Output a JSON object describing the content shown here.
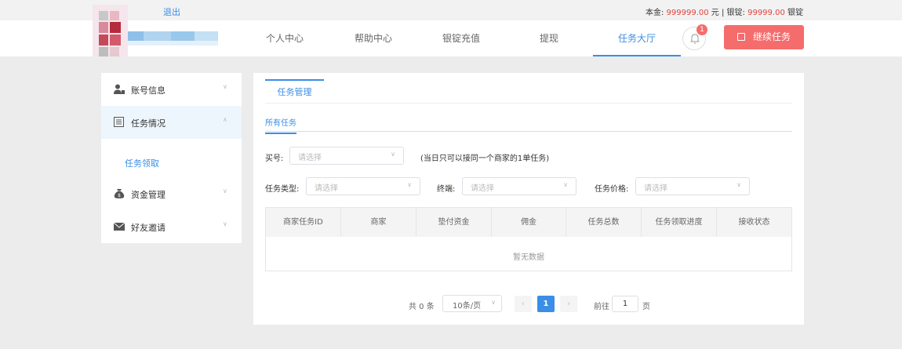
{
  "topbar": {
    "logout": "退出",
    "principal_label": "本金:",
    "principal_value": "999999.00",
    "principal_unit": "元",
    "separator": "|",
    "ingot_label": "银锭:",
    "ingot_value": "99999.00",
    "ingot_unit": "银锭"
  },
  "nav": {
    "items": [
      "个人中心",
      "帮助中心",
      "银锭充值",
      "提现",
      "任务大厅"
    ],
    "active_index": 4,
    "notification_count": "1",
    "continue_button": "继续任务"
  },
  "sidebar": {
    "items": [
      {
        "label": "账号信息",
        "icon": "user-icon"
      },
      {
        "label": "任务情况",
        "icon": "list-icon"
      },
      {
        "label": "资金管理",
        "icon": "money-bag-icon"
      },
      {
        "label": "好友邀请",
        "icon": "envelope-icon"
      }
    ],
    "sub_item": "任务领取"
  },
  "main": {
    "tab": "任务管理",
    "subtab": "所有任务",
    "filters": {
      "buyer_label": "买号:",
      "buyer_placeholder": "请选择",
      "note": "(当日只可以接同一个商家的1单任务)",
      "task_type_label": "任务类型:",
      "task_type_placeholder": "请选择",
      "terminal_label": "终端:",
      "terminal_placeholder": "请选择",
      "price_label": "任务价格:",
      "price_placeholder": "请选择"
    },
    "table": {
      "columns": [
        "商家任务ID",
        "商家",
        "垫付资金",
        "佣金",
        "任务总数",
        "任务领取进度",
        "接收状态"
      ],
      "empty_text": "暂无数据"
    },
    "pagination": {
      "total": "共 0 条",
      "page_size": "10条/页",
      "current_page": "1",
      "goto_label": "前往",
      "goto_value": "1",
      "page_unit": "页"
    }
  },
  "colors": {
    "accent": "#3a8ee6",
    "danger": "#f56c6c",
    "background": "#ececec"
  }
}
